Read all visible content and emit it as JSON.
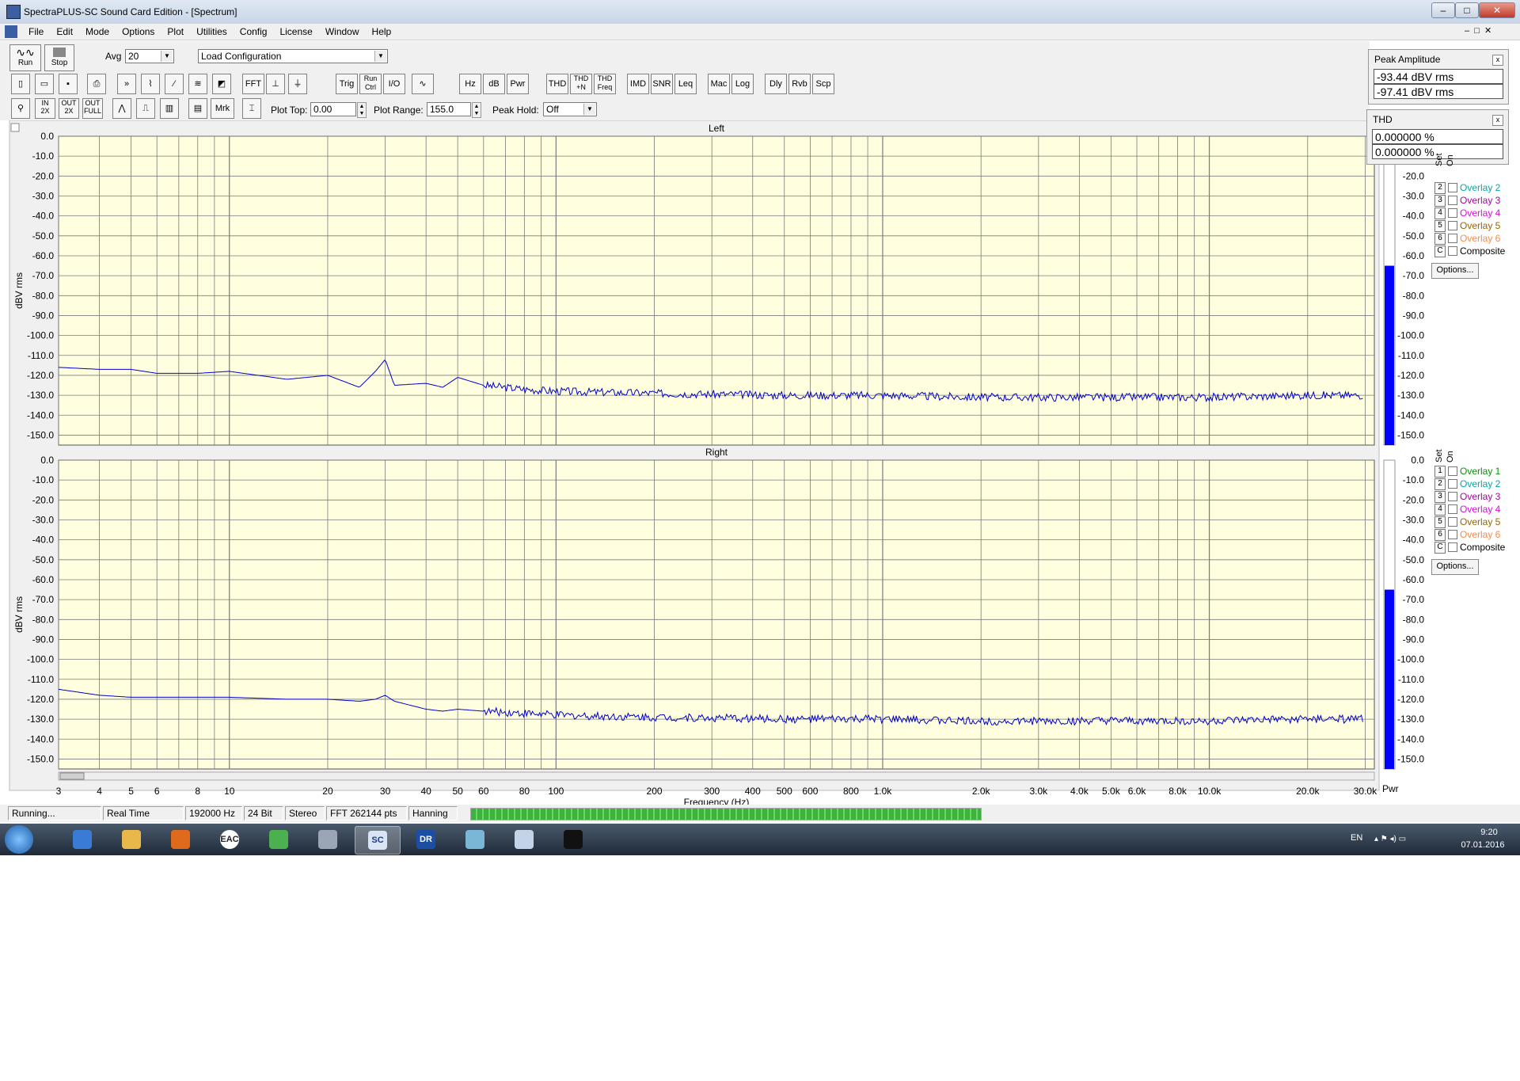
{
  "window": {
    "title": "SpectraPLUS-SC Sound Card Edition - [Spectrum]",
    "min": "–",
    "max": "□",
    "close": "✕"
  },
  "menu": [
    "File",
    "Edit",
    "Mode",
    "Options",
    "Plot",
    "Utilities",
    "Config",
    "License",
    "Window",
    "Help"
  ],
  "toolbar1": {
    "run": "Run",
    "stop": "Stop",
    "avg_label": "Avg",
    "avg_value": "20",
    "config_value": "Load Configuration"
  },
  "toolbar2": [
    "FFT",
    "Trig",
    "Run Ctrl",
    "I/O",
    "Hz",
    "dB",
    "Pwr",
    "THD",
    "THD +N",
    "THD Freq",
    "IMD",
    "SNR",
    "Leq",
    "Mac",
    "Log",
    "Dly",
    "Rvb",
    "Scp"
  ],
  "toolbar3": {
    "mrk": "Mrk",
    "plot_top_label": "Plot Top:",
    "plot_top_value": "0.00",
    "plot_range_label": "Plot Range:",
    "plot_range_value": "155.0",
    "peak_hold_label": "Peak Hold:",
    "peak_hold_value": "Off"
  },
  "peak_amplitude": {
    "title": "Peak Amplitude",
    "values": [
      "-93.44 dBV rms",
      "-97.41 dBV rms"
    ]
  },
  "thd": {
    "title": "THD",
    "values": [
      "0.000000 %",
      "0.000000 %"
    ]
  },
  "overlay_panel": {
    "set_label": "Set",
    "on_label": "On",
    "items": [
      {
        "num": "1",
        "label": "Overlay 1",
        "color": "#009900"
      },
      {
        "num": "2",
        "label": "Overlay 2",
        "color": "#00aaaa"
      },
      {
        "num": "3",
        "label": "Overlay 3",
        "color": "#aa00aa"
      },
      {
        "num": "4",
        "label": "Overlay 4",
        "color": "#ee00ee"
      },
      {
        "num": "5",
        "label": "Overlay 5",
        "color": "#996600"
      },
      {
        "num": "6",
        "label": "Overlay 6",
        "color": "#ff8844"
      },
      {
        "num": "C",
        "label": "Composite",
        "color": "#000000"
      }
    ],
    "options": "Options..."
  },
  "pwr_label": "Pwr",
  "chart_data": {
    "type": "line",
    "panels": [
      {
        "title": "Left",
        "ylabel": "dBV rms",
        "x": [
          3,
          4,
          5,
          6,
          8,
          10,
          15,
          20,
          25,
          28,
          30,
          32,
          40,
          45,
          50,
          60,
          80,
          100,
          200,
          500,
          1000,
          2000,
          4000,
          10000,
          20000,
          30000
        ],
        "y": [
          -116,
          -117,
          -117,
          -119,
          -119,
          -118,
          -122,
          -120,
          -126,
          -118,
          -112,
          -125,
          -124,
          -126,
          -121,
          -125,
          -127,
          -128,
          -129,
          -130,
          -130,
          -131,
          -131,
          -131,
          -130,
          -130
        ]
      },
      {
        "title": "Right",
        "ylabel": "dBV rms",
        "x": [
          3,
          4,
          5,
          6,
          8,
          10,
          15,
          20,
          25,
          28,
          30,
          32,
          40,
          45,
          50,
          60,
          80,
          100,
          200,
          500,
          1000,
          2000,
          4000,
          10000,
          20000,
          30000
        ],
        "y": [
          -115,
          -118,
          -119,
          -119,
          -119,
          -119,
          -120,
          -120,
          -121,
          -120,
          -118,
          -121,
          -125,
          -126,
          -125,
          -126,
          -127,
          -128,
          -129,
          -130,
          -130,
          -131,
          -131,
          -131,
          -130,
          -130
        ]
      }
    ],
    "ylim": [
      -155,
      0
    ],
    "yticks": [
      "0.0",
      "-10.0",
      "-20.0",
      "-30.0",
      "-40.0",
      "-50.0",
      "-60.0",
      "-70.0",
      "-80.0",
      "-90.0",
      "-100.0",
      "-110.0",
      "-120.0",
      "-130.0",
      "-140.0",
      "-150.0"
    ],
    "xlim": [
      3,
      32000
    ],
    "x_scale": "log",
    "xticks": [
      {
        "v": 3,
        "t": "3"
      },
      {
        "v": 4,
        "t": "4"
      },
      {
        "v": 5,
        "t": "5"
      },
      {
        "v": 6,
        "t": "6"
      },
      {
        "v": 8,
        "t": "8"
      },
      {
        "v": 10,
        "t": "10"
      },
      {
        "v": 20,
        "t": "20"
      },
      {
        "v": 30,
        "t": "30"
      },
      {
        "v": 40,
        "t": "40"
      },
      {
        "v": 50,
        "t": "50"
      },
      {
        "v": 60,
        "t": "60"
      },
      {
        "v": 80,
        "t": "80"
      },
      {
        "v": 100,
        "t": "100"
      },
      {
        "v": 200,
        "t": "200"
      },
      {
        "v": 300,
        "t": "300"
      },
      {
        "v": 400,
        "t": "400"
      },
      {
        "v": 500,
        "t": "500"
      },
      {
        "v": 600,
        "t": "600"
      },
      {
        "v": 800,
        "t": "800"
      },
      {
        "v": 1000,
        "t": "1.0k"
      },
      {
        "v": 2000,
        "t": "2.0k"
      },
      {
        "v": 3000,
        "t": "3.0k"
      },
      {
        "v": 4000,
        "t": "4.0k"
      },
      {
        "v": 5000,
        "t": "5.0k"
      },
      {
        "v": 6000,
        "t": "6.0k"
      },
      {
        "v": 8000,
        "t": "8.0k"
      },
      {
        "v": 10000,
        "t": "10.0k"
      },
      {
        "v": 20000,
        "t": "20.0k"
      },
      {
        "v": 30000,
        "t": "30.0k"
      }
    ],
    "xlabel": "Frequency (Hz)",
    "meter_yticks": [
      "0.0",
      "-10.0",
      "-20.0",
      "-30.0",
      "-40.0",
      "-50.0",
      "-60.0",
      "-70.0",
      "-80.0",
      "-90.0",
      "-100.0",
      "-110.0",
      "-120.0",
      "-130.0",
      "-140.0",
      "-150.0"
    ],
    "meter_level": [
      -65,
      -65
    ],
    "plot_bg": "#ffffe0",
    "line_color": "#0000cc",
    "grid_color": "#7a7a7a",
    "meter_color": "#0000ff"
  },
  "status": [
    "Running...",
    "Real Time",
    "192000 Hz",
    "24 Bit",
    "Stereo",
    "FFT 262144 pts",
    "Hanning"
  ],
  "status_progress": 1.0,
  "taskbar": {
    "apps": [
      "outlook-icon",
      "explorer-icon",
      "firefox-icon",
      "eac-icon",
      "chrome-icon",
      "app-icon",
      "spectraplus-icon",
      "dr-icon",
      "notes-icon",
      "tool-icon",
      "cmd-icon"
    ],
    "eac": "EAC",
    "sc": "SC",
    "dr": "DR",
    "lang": "EN",
    "time": "9:20",
    "date": "07.01.2016"
  }
}
